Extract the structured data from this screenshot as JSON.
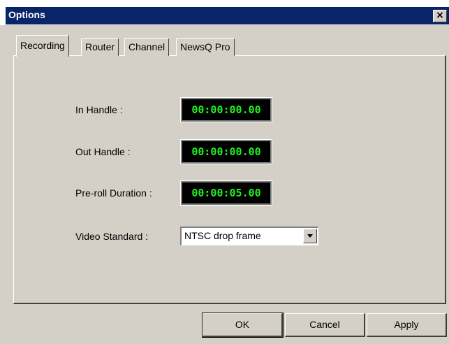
{
  "window": {
    "title": "Options",
    "close_glyph": "×"
  },
  "tabs": [
    {
      "label": "Recording",
      "active": true
    },
    {
      "label": "Router",
      "active": false
    },
    {
      "label": "Channel",
      "active": false
    },
    {
      "label": "NewsQ Pro",
      "active": false
    }
  ],
  "recording": {
    "in_handle": {
      "label": "In Handle :",
      "value": "00:00:00.00"
    },
    "out_handle": {
      "label": "Out Handle :",
      "value": "00:00:00.00"
    },
    "preroll": {
      "label": "Pre-roll Duration :",
      "value": "00:00:05.00"
    },
    "video_standard": {
      "label": "Video Standard :",
      "value": "NTSC drop frame"
    }
  },
  "buttons": {
    "ok": "OK",
    "cancel": "Cancel",
    "apply": "Apply"
  },
  "colors": {
    "titlebar": "#0a246a",
    "face": "#d4d0c8",
    "timecode_fg": "#22ee22",
    "timecode_bg": "#000000"
  }
}
